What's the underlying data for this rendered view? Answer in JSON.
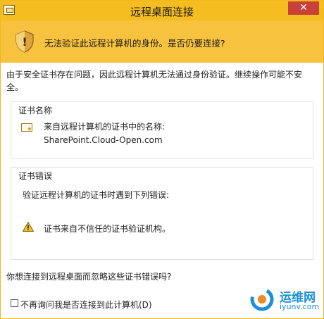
{
  "window": {
    "title": "远程桌面连接",
    "close_label": "✕"
  },
  "banner": {
    "message": "无法验证此远程计算机的身份。是否仍要连接?"
  },
  "description": "由于安全证书存在问题，因此远程计算机无法通过身份验证。继续操作可能不安全。",
  "cert_name_group": {
    "label": "证书名称",
    "line1": "来自远程计算机的证书中的名称:",
    "line2": "SharePoint.Cloud-Open.com"
  },
  "cert_error_group": {
    "label": "证书错误",
    "line1": "验证远程计算机的证书时遇到下列错误:",
    "error_item": "证书来自不信任的证书验证机构。"
  },
  "question": "你想连接到远程桌面而忽略这些证书错误吗?",
  "dont_ask": {
    "label": "不再询问我是否连接到此计算机(D)",
    "checked": false
  },
  "watermark": {
    "text_top": "运维网",
    "text_bottom": "iyunv.com"
  },
  "colors": {
    "titlebar": "#f5bd1f",
    "banner": "#f7c23e",
    "close": "#c7403a",
    "watermark": "#1a8fd6"
  }
}
